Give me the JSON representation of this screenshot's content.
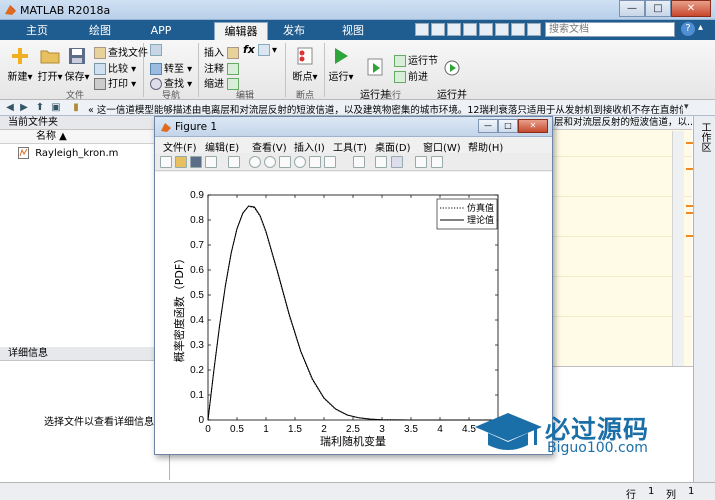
{
  "window": {
    "title": "MATLAB R2018a",
    "controls": {
      "minimize": "—",
      "maximize": "□",
      "close": "✕"
    }
  },
  "tabs": [
    "主页",
    "绘图",
    "APP",
    "编辑器",
    "发布",
    "视图"
  ],
  "active_tab": "编辑器",
  "search": {
    "placeholder": "搜索文档"
  },
  "ribbon": {
    "file": {
      "new": "新建",
      "open": "打开",
      "save": "保存",
      "find_files": "查找文件",
      "compare": "比较",
      "print": "打印",
      "group": "文件"
    },
    "navigate": {
      "goto": "转至",
      "find": "查找",
      "group": "导航"
    },
    "edit": {
      "insert": "插入",
      "comment": "注释",
      "indent": "缩进",
      "fx": "fx",
      "group": "编辑"
    },
    "breakpoints": {
      "label": "断点",
      "group": "断点"
    },
    "run": {
      "run": "运行",
      "run_advance": "运行并\n前进",
      "run_section": "运行节",
      "advance": "前进",
      "run_time": "运行并\n计时",
      "group": "运行"
    }
  },
  "address": {
    "path": "« 这一信道模型能够描述由电离层和对流层反射的短波信道，以及建筑物密集的城市环境。12瑞利衰落只适用于从发射机到接收机不存在直射信号（LoS，L..."
  },
  "current_folder": {
    "title": "当前文件夹",
    "name_col": "名称 ▲",
    "files": [
      "Rayleigh_kron.m"
    ]
  },
  "details": {
    "title": "详细信息",
    "message": "选择文件以查看详细信息"
  },
  "editor": {
    "header_text": "层和对流层反射的短波信道，以..."
  },
  "workspace": {
    "label": "工作区"
  },
  "status": {
    "row_label": "行",
    "row": "1",
    "col_label": "列",
    "col": "1"
  },
  "figure": {
    "title": "Figure 1",
    "menu": [
      "文件(F)",
      "编辑(E)",
      "查看(V)",
      "插入(I)",
      "工具(T)",
      "桌面(D)",
      "窗口(W)",
      "帮助(H)"
    ]
  },
  "chart_data": {
    "type": "line",
    "title": "",
    "xlabel": "瑞利随机变量",
    "ylabel": "概率密度函数（PDF）",
    "xlim": [
      0,
      5
    ],
    "ylim": [
      0,
      0.9
    ],
    "xticks": [
      0,
      0.5,
      1,
      1.5,
      2,
      2.5,
      3,
      3.5,
      4,
      4.5,
      5
    ],
    "yticks": [
      0,
      0.1,
      0.2,
      0.3,
      0.4,
      0.5,
      0.6,
      0.7,
      0.8,
      0.9
    ],
    "legend_position": "top-right",
    "series": [
      {
        "name": "仿真值",
        "style": "dotted",
        "x": [
          0,
          0.1,
          0.2,
          0.3,
          0.4,
          0.5,
          0.6,
          0.7,
          0.8,
          0.9,
          1.0,
          1.2,
          1.4,
          1.6,
          1.8,
          2.0,
          2.2,
          2.4,
          2.6,
          2.8,
          3.0,
          3.5,
          4.0,
          4.5,
          5.0
        ],
        "y": [
          0,
          0.196,
          0.378,
          0.538,
          0.669,
          0.766,
          0.828,
          0.855,
          0.849,
          0.814,
          0.751,
          0.589,
          0.419,
          0.272,
          0.161,
          0.087,
          0.043,
          0.02,
          0.0088,
          0.0035,
          0.0013,
          8e-05,
          4e-06,
          0,
          0
        ]
      },
      {
        "name": "理论值",
        "style": "solid",
        "x": [
          0,
          0.1,
          0.2,
          0.3,
          0.4,
          0.5,
          0.6,
          0.7,
          0.8,
          0.9,
          1.0,
          1.2,
          1.4,
          1.6,
          1.8,
          2.0,
          2.2,
          2.4,
          2.6,
          2.8,
          3.0,
          3.5,
          4.0,
          4.5,
          5.0
        ],
        "y": [
          0,
          0.196,
          0.378,
          0.537,
          0.668,
          0.765,
          0.827,
          0.856,
          0.852,
          0.817,
          0.754,
          0.593,
          0.423,
          0.275,
          0.164,
          0.088,
          0.044,
          0.02,
          0.0089,
          0.0035,
          0.0012,
          8e-05,
          4e-06,
          0,
          0
        ]
      }
    ]
  },
  "watermark": {
    "brand": "必过源码",
    "site": "Biguo100.com"
  },
  "colors": {
    "ribbon_tab_bar": "#1f5c8f",
    "editor_bg": "#fffbe6",
    "mark": "#ee8a20",
    "watermark": "#1b6fa8"
  }
}
